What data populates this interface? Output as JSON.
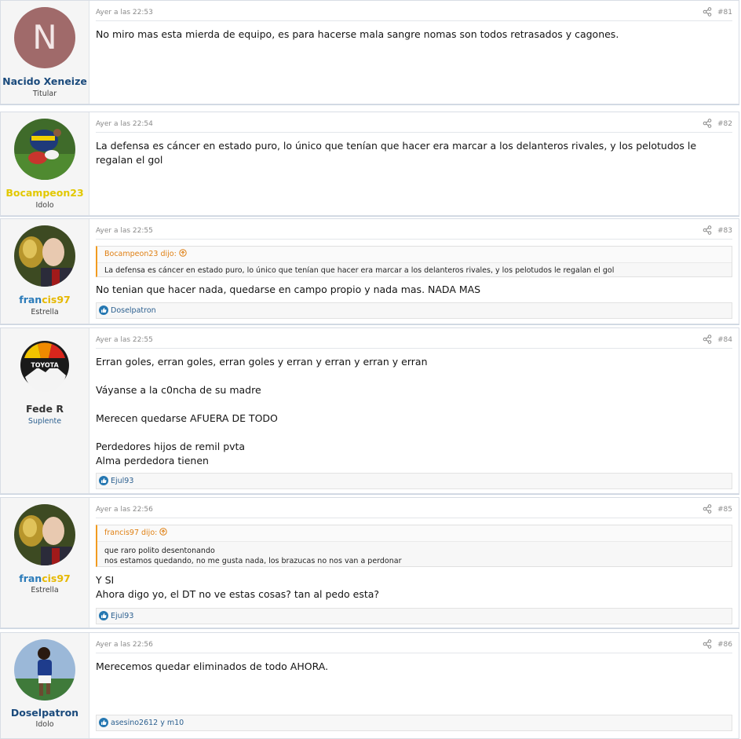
{
  "posts": [
    {
      "user": {
        "name": "Nacido Xeneize",
        "title": "Titular",
        "name_color": "#1a4a7c",
        "avatar_letter": "N"
      },
      "date": "Ayer a las 22:53",
      "number": "#81",
      "text": "No miro mas esta mierda de equipo, es para hacerse mala sangre nomas son todos retrasados y cagones."
    },
    {
      "user": {
        "name": "Bocampeon23",
        "title": "Idolo",
        "name_color": "#e2c800"
      },
      "date": "Ayer a las 22:54",
      "number": "#82",
      "text": "La defensa es cáncer en estado puro, lo único que tenían que hacer era marcar a los delanteros rivales, y los pelotudos le regalan el gol"
    },
    {
      "user": {
        "name": "francis97",
        "name_a": "fran",
        "name_b": "cis97",
        "title": "Estrella"
      },
      "date": "Ayer a las 22:55",
      "number": "#83",
      "quote": {
        "author": "Bocampeon23 dijo:",
        "text": "La defensa es cáncer en estado puro, lo único que tenían que hacer era marcar a los delanteros rivales, y los pelotudos le regalan el gol"
      },
      "text": "No tenian que hacer nada, quedarse en campo propio y nada mas. NADA MAS",
      "reactions": "Doselpatron"
    },
    {
      "user": {
        "name": "Fede R",
        "title": "Suplente",
        "avatar_text": "TOYOTA"
      },
      "date": "Ayer a las 22:55",
      "number": "#84",
      "text": "Erran goles, erran goles, erran goles y erran y erran y erran y erran\n\nVáyanse a la c0ncha de su madre\n\nMerecen quedarse AFUERA DE TODO\n\nPerdedores hijos de remil pvta\nAlma perdedora tienen",
      "reactions": "Ejul93"
    },
    {
      "user": {
        "name": "francis97",
        "name_a": "fran",
        "name_b": "cis97",
        "title": "Estrella"
      },
      "date": "Ayer a las 22:56",
      "number": "#85",
      "quote": {
        "author": "francis97 dijo:",
        "text": "que raro polito desentonando\nnos estamos quedando, no me gusta nada, los brazucas no nos van a perdonar"
      },
      "text": "Y SI\nAhora digo yo, el DT no ve estas cosas? tan al pedo esta?",
      "reactions": "Ejul93"
    },
    {
      "user": {
        "name": "Doselpatron",
        "title": "Idolo",
        "name_color": "#1a4a7c"
      },
      "date": "Ayer a las 22:56",
      "number": "#86",
      "text": "Merecemos quedar eliminados de todo AHORA.",
      "reactions": "asesino2612 y m10"
    }
  ],
  "colors": {
    "accent_blue": "#2577b1",
    "quote_orange": "#df7f12",
    "francis_a": "#2b7bb9",
    "francis_b": "#e6b800"
  },
  "icons": {
    "share": "share-icon",
    "like": "like-icon",
    "quote_arrow": "arrow-up-circle-icon"
  }
}
